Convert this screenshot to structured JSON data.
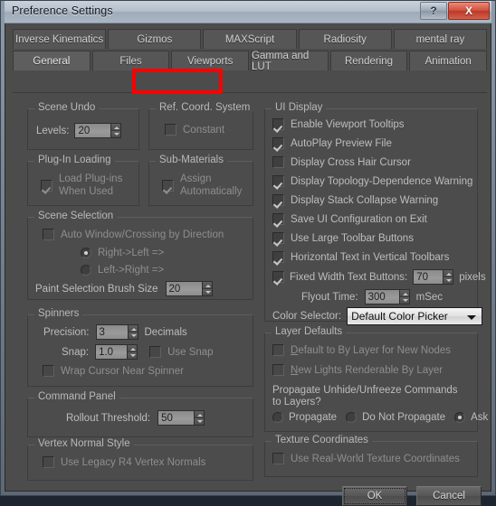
{
  "window": {
    "title": "Preference Settings",
    "help_label": "?",
    "close_label": "X"
  },
  "tabs": {
    "row1": [
      {
        "label": "Inverse Kinematics"
      },
      {
        "label": "Gizmos"
      },
      {
        "label": "MAXScript"
      },
      {
        "label": "Radiosity"
      },
      {
        "label": "mental ray"
      }
    ],
    "row2": [
      {
        "label": "General"
      },
      {
        "label": "Files"
      },
      {
        "label": "Viewports"
      },
      {
        "label": "Gamma and LUT"
      },
      {
        "label": "Rendering"
      },
      {
        "label": "Animation"
      }
    ]
  },
  "annotation": {
    "color": "#fa0000",
    "target": "Viewports"
  },
  "scene_undo": {
    "legend": "Scene Undo",
    "levels_label": "Levels:",
    "levels_value": "20"
  },
  "ref_coord": {
    "legend": "Ref. Coord. System",
    "constant_label": "Constant",
    "constant_checked": false
  },
  "plugin_loading": {
    "legend": "Plug-In Loading",
    "load_label_line1": "Load Plug-ins",
    "load_label_line2": "When Used",
    "load_checked": true
  },
  "sub_materials": {
    "legend": "Sub-Materials",
    "assign_label_line1": "Assign",
    "assign_label_line2": "Automatically",
    "assign_checked": true
  },
  "scene_selection": {
    "legend": "Scene Selection",
    "auto_window_label": "Auto Window/Crossing by Direction",
    "auto_window_checked": false,
    "right_left_label": "Right->Left =>",
    "right_left_selected": true,
    "left_right_label": "Left->Right =>",
    "left_right_selected": false,
    "brush_size_label": "Paint Selection Brush Size",
    "brush_size_value": "20"
  },
  "spinners": {
    "legend": "Spinners",
    "precision_label": "Precision:",
    "precision_value": "3",
    "decimals_label": "Decimals",
    "snap_label": "Snap:",
    "snap_value": "1.0",
    "use_snap_label": "Use Snap",
    "use_snap_checked": false,
    "wrap_cursor_label": "Wrap Cursor Near Spinner",
    "wrap_cursor_checked": false
  },
  "command_panel": {
    "legend": "Command Panel",
    "rollout_label": "Rollout Threshold:",
    "rollout_value": "50"
  },
  "vertex_normal": {
    "legend": "Vertex Normal Style",
    "legacy_label": "Use Legacy R4 Vertex Normals",
    "legacy_checked": false
  },
  "ui_display": {
    "legend": "UI Display",
    "items": [
      {
        "label": "Enable Viewport Tooltips",
        "checked": true
      },
      {
        "label": "AutoPlay Preview File",
        "checked": true
      },
      {
        "label": "Display Cross Hair Cursor",
        "checked": false
      },
      {
        "label": "Display Topology-Dependence Warning",
        "checked": true
      },
      {
        "label": "Display Stack Collapse Warning",
        "checked": true
      },
      {
        "label": "Save UI Configuration on Exit",
        "checked": true
      },
      {
        "label": "Use Large Toolbar Buttons",
        "checked": true
      },
      {
        "label": "Horizontal Text in Vertical Toolbars",
        "checked": true
      }
    ],
    "fixed_width_label": "Fixed Width Text Buttons:",
    "fixed_width_checked": true,
    "fixed_width_value": "70",
    "pixels_label": "pixels",
    "flyout_label": "Flyout Time:",
    "flyout_value": "300",
    "msec_label": "mSec",
    "color_selector_label": "Color Selector:",
    "color_selector_value": "Default Color Picker"
  },
  "layer_defaults": {
    "legend": "Layer Defaults",
    "default_bylayer_acc": "D",
    "default_bylayer_rest": "efault to By Layer for New Nodes",
    "default_bylayer_checked": false,
    "new_lights_acc": "N",
    "new_lights_rest": "ew Lights Renderable By Layer",
    "new_lights_checked": false,
    "propagate_question_line1": "Propagate Unhide/Unfreeze Commands",
    "propagate_question_line2": "to Layers?",
    "options": [
      {
        "label": "Propagate",
        "selected": false
      },
      {
        "label": "Do Not Propagate",
        "selected": false
      },
      {
        "label": "Ask",
        "selected": true
      }
    ]
  },
  "texture_coordinates": {
    "legend": "Texture Coordinates",
    "real_world_label": "Use Real-World Texture Coordinates",
    "real_world_checked": false
  },
  "footer": {
    "ok_label": "OK",
    "cancel_label": "Cancel"
  }
}
